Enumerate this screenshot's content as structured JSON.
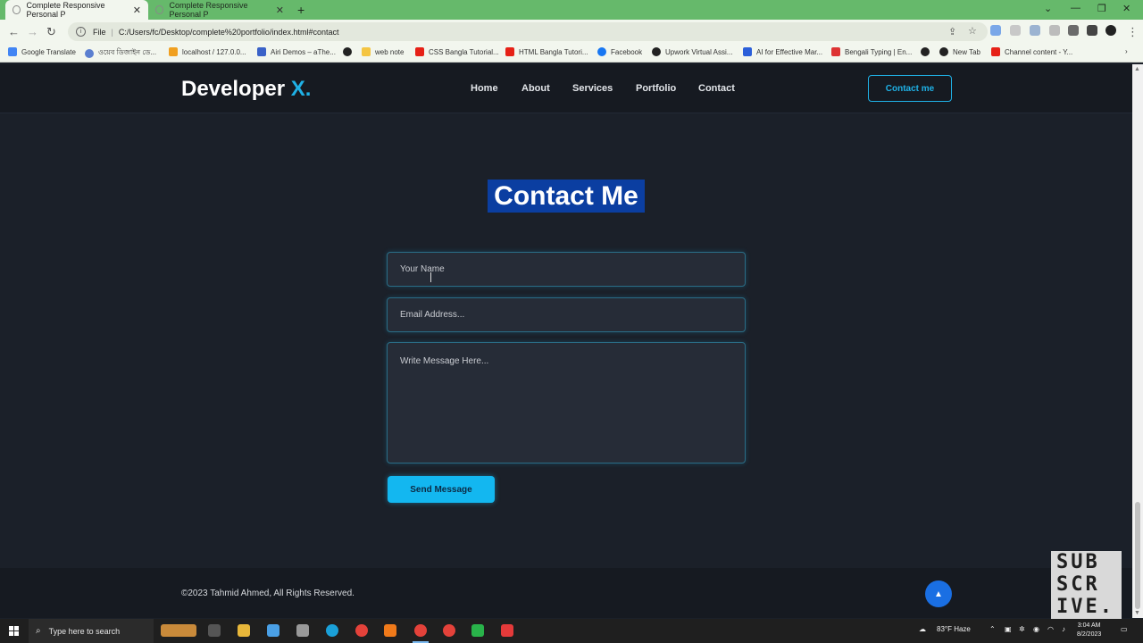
{
  "browser": {
    "tabs": [
      {
        "title": "Complete Responsive Personal P",
        "active": true
      },
      {
        "title": "Complete Responsive Personal P",
        "active": false
      }
    ],
    "address": {
      "scheme_label": "File",
      "url": "C:/Users/fc/Desktop/complete%20portfolio/index.html#contact"
    },
    "bookmarks": [
      {
        "label": "Google Translate",
        "icon": "translate-icon",
        "color": "#4285f4"
      },
      {
        "label": "ওয়েব ডিজাইন ডে...",
        "icon": "globe-icon",
        "color": "#5b7fd0"
      },
      {
        "label": "localhost / 127.0.0...",
        "icon": "phpmyadmin-icon",
        "color": "#f0a020"
      },
      {
        "label": "Airi Demos – aThe...",
        "icon": "airi-icon",
        "color": "#3a62c8"
      },
      {
        "label": "",
        "icon": "github-icon",
        "color": "#222222"
      },
      {
        "label": "web note",
        "icon": "folder-icon",
        "color": "#f4c542"
      },
      {
        "label": "CSS Bangla Tutorial...",
        "icon": "youtube-icon",
        "color": "#e62117"
      },
      {
        "label": "HTML Bangla Tutori...",
        "icon": "youtube-icon",
        "color": "#e62117"
      },
      {
        "label": "Facebook",
        "icon": "facebook-icon",
        "color": "#1877f2"
      },
      {
        "label": "Upwork Virtual Assi...",
        "icon": "github-icon",
        "color": "#222222"
      },
      {
        "label": "AI for Effective Mar...",
        "icon": "k-icon",
        "color": "#2b5fd9"
      },
      {
        "label": "Bengali Typing | En...",
        "icon": "it-icon",
        "color": "#d33"
      },
      {
        "label": "",
        "icon": "github-icon",
        "color": "#222222"
      },
      {
        "label": "New Tab",
        "icon": "github-icon",
        "color": "#222222"
      },
      {
        "label": "Channel content - Y...",
        "icon": "youtube-icon",
        "color": "#e62117"
      }
    ]
  },
  "site": {
    "logo": {
      "text": "Developer",
      "accent": "X."
    },
    "nav": [
      "Home",
      "About",
      "Services",
      "Portfolio",
      "Contact"
    ],
    "cta": "Contact me",
    "accent_color": "#1fb1e6"
  },
  "contact": {
    "title": "Contact Me",
    "name_placeholder": "Your Name",
    "email_placeholder": "Email Address...",
    "message_placeholder": "Write Message Here...",
    "send_label": "Send Message"
  },
  "footer": {
    "copyright": "©2023 Tahmid Ahmed, All Rights Reserved."
  },
  "overlay": {
    "subscribe_lines": [
      "SUB",
      "SCR",
      "IVE."
    ]
  },
  "taskbar": {
    "search_placeholder": "Type here to search",
    "weather": "83°F  Haze",
    "time": "3:04 AM",
    "date": "8/2/2023"
  }
}
